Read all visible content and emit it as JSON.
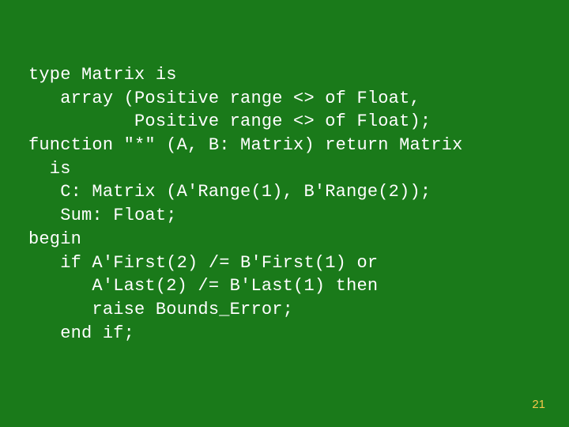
{
  "code": {
    "l1": "type Matrix is",
    "l2": "   array (Positive range <> of Float,",
    "l3": "          Positive range <> of Float);",
    "l4": "function \"*\" (A, B: Matrix) return Matrix",
    "l5": "  is",
    "l6": "   C: Matrix (A'Range(1), B'Range(2));",
    "l7": "   Sum: Float;",
    "l8": "begin",
    "l9": "   if A'First(2) /= B'First(1) or",
    "l10": "      A'Last(2) /= B'Last(1) then",
    "l11": "      raise Bounds_Error;",
    "l12": "   end if;"
  },
  "page_number": "21"
}
